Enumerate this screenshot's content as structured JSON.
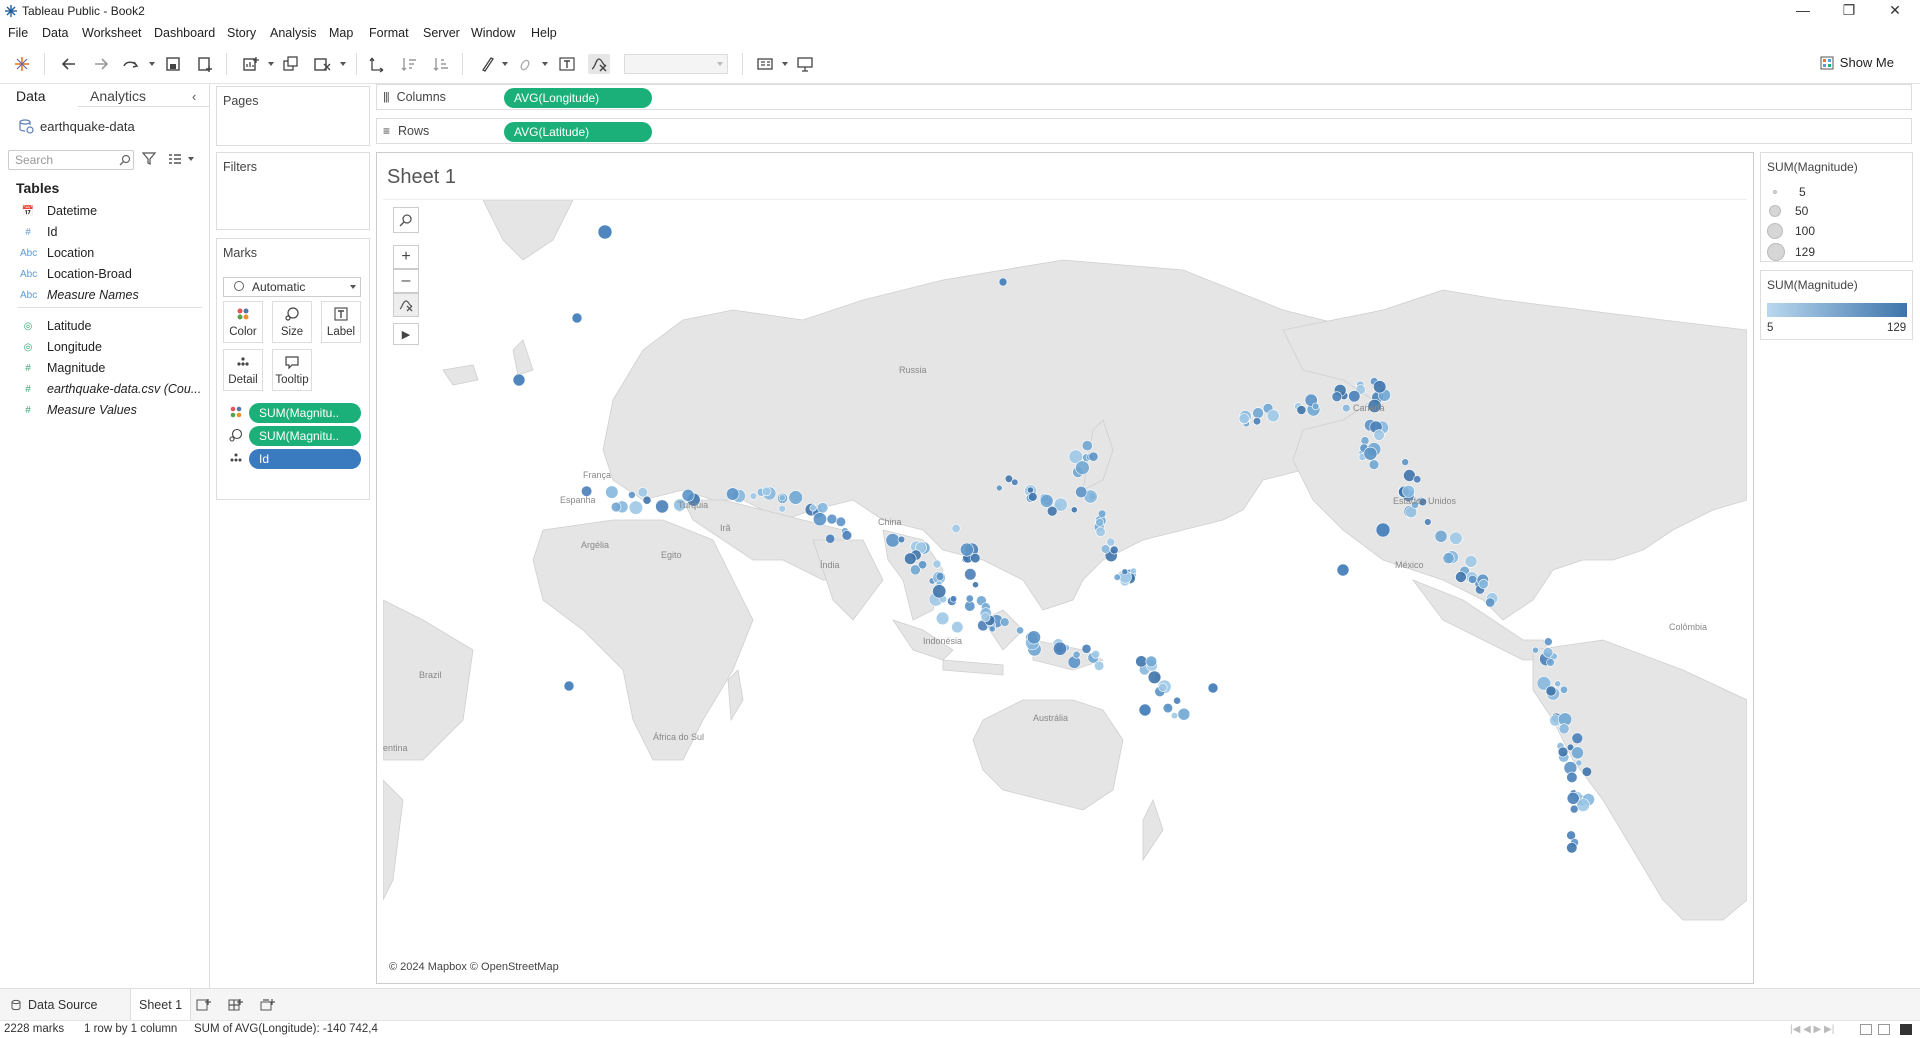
{
  "window": {
    "title": "Tableau Public - Book2"
  },
  "menu": [
    "File",
    "Data",
    "Worksheet",
    "Dashboard",
    "Story",
    "Analysis",
    "Map",
    "Format",
    "Server",
    "Window",
    "Help"
  ],
  "toolbar": {
    "show_me": "Show Me"
  },
  "data_pane": {
    "tab_data": "Data",
    "tab_analytics": "Analytics",
    "datasource": "earthquake-data",
    "search_placeholder": "Search",
    "tables_heading": "Tables",
    "fields": [
      {
        "name": "Datetime",
        "icon": "calendar-icon"
      },
      {
        "name": "Id",
        "icon": "#"
      },
      {
        "name": "Location",
        "icon": "Abc"
      },
      {
        "name": "Location-Broad",
        "icon": "Abc"
      },
      {
        "name": "Measure Names",
        "icon": "Abc"
      },
      {
        "name": "Latitude",
        "icon": "globe-icon"
      },
      {
        "name": "Longitude",
        "icon": "globe-icon"
      },
      {
        "name": "Magnitude",
        "icon": "#"
      },
      {
        "name": "earthquake-data.csv (Cou...",
        "icon": "#"
      },
      {
        "name": "Measure Values",
        "icon": "#"
      }
    ]
  },
  "shelves": {
    "pages": "Pages",
    "filters": "Filters",
    "marks": "Marks",
    "mark_type": "Automatic",
    "cards": {
      "color": "Color",
      "size": "Size",
      "label": "Label",
      "detail": "Detail",
      "tooltip": "Tooltip"
    },
    "mark_pills": [
      "SUM(Magnitu..",
      "SUM(Magnitu..",
      "Id"
    ],
    "columns_label": "Columns",
    "rows_label": "Rows",
    "columns_pill": "AVG(Longitude)",
    "rows_pill": "AVG(Latitude)"
  },
  "sheet": {
    "title": "Sheet 1",
    "attribution": "© 2024 Mapbox © OpenStreetMap",
    "map_labels": [
      "Russia",
      "Canadá",
      "França",
      "Espanha",
      "Turquia",
      "Irã",
      "China",
      "Argélia",
      "Egito",
      "Índia",
      "Estados Unidos",
      "México",
      "Colômbia",
      "Brazil",
      "Indonésia",
      "Austrália",
      "África do Sul",
      "entina"
    ]
  },
  "legends": {
    "size_title": "SUM(Magnitude)",
    "size_items": [
      "5",
      "50",
      "100",
      "129"
    ],
    "color_title": "SUM(Magnitude)",
    "color_min": "5",
    "color_max": "129",
    "color_min_hex": "#b9d8ef",
    "color_max_hex": "#3e74ab"
  },
  "tabs": {
    "data_source": "Data Source",
    "sheet": "Sheet 1"
  },
  "status": {
    "marks": "2228 marks",
    "rows": "1 row by 1 column",
    "sum": "SUM of AVG(Longitude): -140 742,4"
  }
}
